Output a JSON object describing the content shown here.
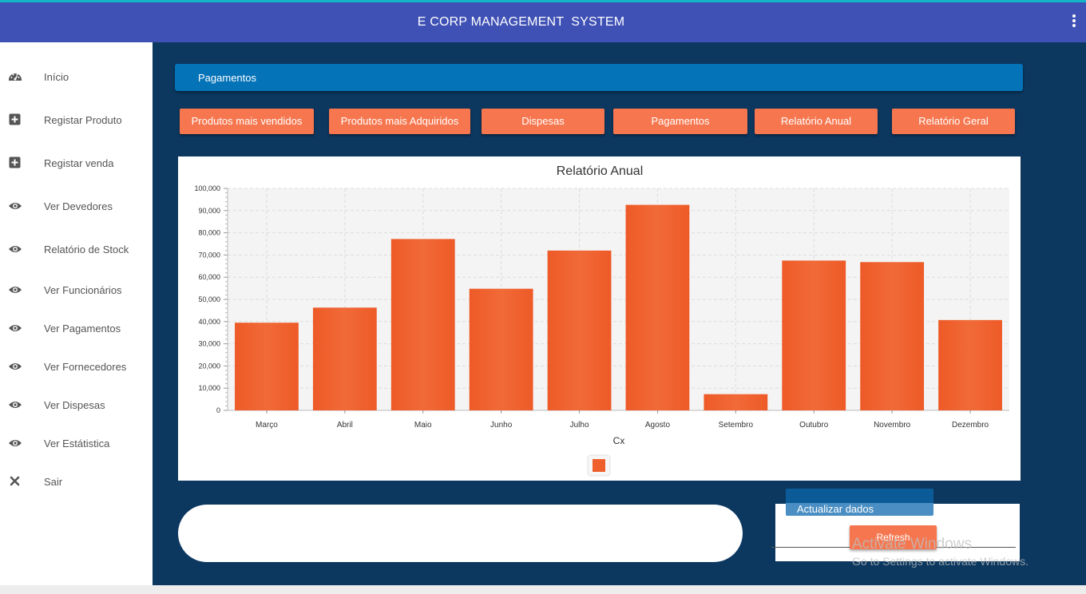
{
  "header": {
    "title": "E CORP MANAGEMENT  SYSTEM"
  },
  "sidebar": {
    "items": [
      {
        "label": "Início",
        "icon": "dashboard-icon"
      },
      {
        "label": "Registar Produto",
        "icon": "plus-square-icon"
      },
      {
        "label": "Registar venda",
        "icon": "plus-square-icon"
      },
      {
        "label": "Ver Devedores",
        "icon": "eye-icon"
      },
      {
        "label": "Relatório de Stock",
        "icon": "eye-icon"
      },
      {
        "label": "Ver Funcionários",
        "icon": "eye-icon"
      },
      {
        "label": "Ver Pagamentos",
        "icon": "eye-icon"
      },
      {
        "label": "Ver Fornecedores",
        "icon": "eye-icon"
      },
      {
        "label": "Ver Dispesas",
        "icon": "eye-icon"
      },
      {
        "label": "Ver Estátistica",
        "icon": "eye-icon"
      },
      {
        "label": "Sair",
        "icon": "close-icon"
      }
    ]
  },
  "section": {
    "title": "Pagamentos"
  },
  "tabs": [
    {
      "label": "Produtos mais vendidos"
    },
    {
      "label": "Produtos mais Adquiridos"
    },
    {
      "label": "Dispesas"
    },
    {
      "label": "Pagamentos"
    },
    {
      "label": "Relatório Anual"
    },
    {
      "label": "Relatório Geral"
    }
  ],
  "chart_data": {
    "type": "bar",
    "title": "Relatório Anual",
    "xlabel": "Cx",
    "ylabel": "",
    "ylim": [
      0,
      100000
    ],
    "yticks": [
      0,
      10000,
      20000,
      30000,
      40000,
      50000,
      60000,
      70000,
      80000,
      90000,
      100000
    ],
    "ytick_labels": [
      "0",
      "10,000",
      "20,000",
      "30,000",
      "40,000",
      "50,000",
      "60,000",
      "70,000",
      "80,000",
      "90,000",
      "100,000"
    ],
    "categories": [
      "Março",
      "Abril",
      "Maio",
      "Junho",
      "Julho",
      "Agosto",
      "Setembro",
      "Outubro",
      "Novembro",
      "Dezembro"
    ],
    "values": [
      39500,
      46300,
      77200,
      54800,
      72000,
      92600,
      7300,
      67500,
      66800,
      40700
    ],
    "grid": true,
    "legend": "bottom-center",
    "color": "#ef5f2c"
  },
  "actions": {
    "update_label": "Actualizar dados",
    "refresh_label": "Refresh"
  },
  "watermark": {
    "line1": "Activate Windows",
    "line2": "Go to Settings to activate Windows."
  },
  "colors": {
    "header": "#3f51b5",
    "main_bg": "#0c3860",
    "section_bar": "#0473b8",
    "button": "#f6774f"
  }
}
